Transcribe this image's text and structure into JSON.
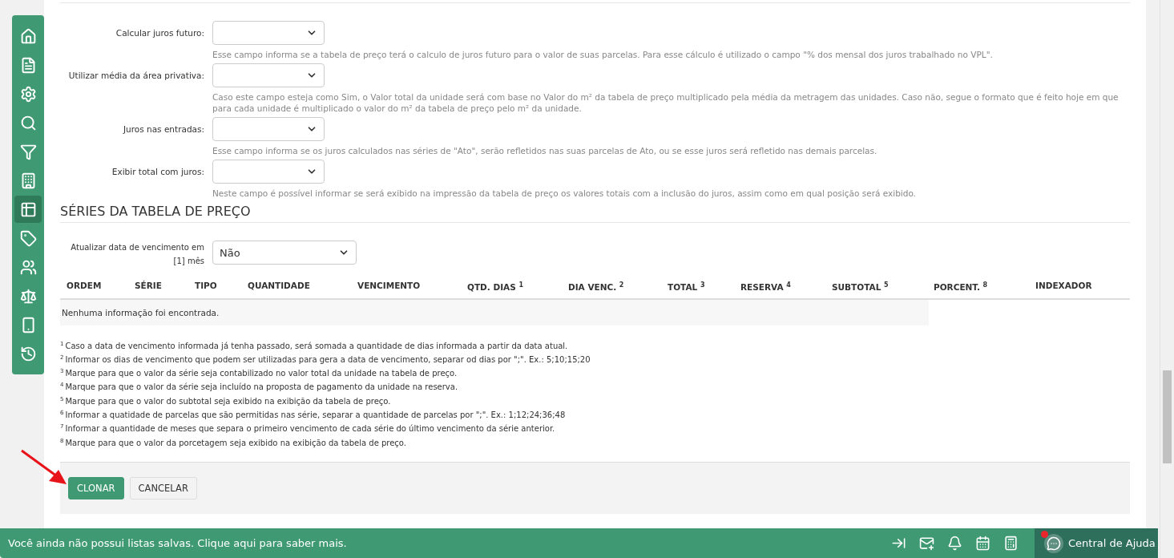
{
  "sidebar": {
    "items": [
      {
        "kind": "home",
        "selected": false
      },
      {
        "kind": "document",
        "selected": false
      },
      {
        "kind": "settings",
        "selected": false
      },
      {
        "kind": "search",
        "selected": false
      },
      {
        "kind": "filter",
        "selected": false
      },
      {
        "kind": "building",
        "selected": false
      },
      {
        "kind": "table",
        "selected": true
      },
      {
        "kind": "tag",
        "selected": false
      },
      {
        "kind": "users",
        "selected": false
      },
      {
        "kind": "scale",
        "selected": false
      },
      {
        "kind": "phone",
        "selected": false
      },
      {
        "kind": "history",
        "selected": false
      }
    ]
  },
  "settings": [
    {
      "label": "Calcular juros futuro:",
      "help": "Esse campo informa se a tabela de preço terá o calculo de juros futuro para o valor de suas parcelas. Para esse cálculo é utilizado o campo \"% dos mensal dos juros trabalhado no VPL\"."
    },
    {
      "label": "Utilizar média da área privativa:",
      "help": "Caso este campo esteja como Sim, o Valor total da unidade será com base no Valor do m² da tabela de preço multiplicado pela média da metragem das unidades. Caso não, segue o formato que é feito hoje em que para cada unidade é multiplicado o valor do m² da tabela de preço pelo m² da unidade."
    },
    {
      "label": "Juros nas entradas:",
      "help": "Esse campo informa se os juros calculados nas séries de \"Ato\", serão refletidos nas suas parcelas de Ato, ou se esse juros será refletido nas demais parcelas."
    },
    {
      "label": "Exibir total com juros:",
      "help": "Neste campo é possível informar se será exibido na impressão da tabela de preço os valores totais com a inclusão do juros, assim como em qual posição será exibido."
    }
  ],
  "series": {
    "title": "SÉRIES DA TABELA DE PREÇO",
    "update_due_date": {
      "label": "Atualizar data de vencimento em [1] mês",
      "value": "Não"
    },
    "table": {
      "columns": [
        "ORDEM",
        "SÉRIE",
        "TIPO",
        "QUANTIDADE",
        "VENCIMENTO",
        "QTD. DIAS $^{1}$",
        "DIA VENC. $^{2}$",
        "TOTAL $^{3}$",
        "RESERVA $^{4}$",
        "SUBTOTAL $^{5}$",
        "PORCENT. $^{8}$",
        "INDEXADOR"
      ],
      "empty_message": "Nenhuma informação foi encontrada."
    },
    "footnotes": [
      {
        "mark": "1",
        "text": "Caso a data de vencimento informada já tenha passado, será somada a quantidade de dias informada a partir da data atual."
      },
      {
        "mark": "2",
        "text": "Informar os dias de vencimento que podem ser utilizadas para gera a data de vencimento, separar od dias por \";\". Ex.: 5;10;15;20"
      },
      {
        "mark": "3",
        "text": "Marque para que o valor da série seja contabilizado no valor total da unidade na tabela de preço."
      },
      {
        "mark": "4",
        "text": "Marque para que o valor da série seja incluído na proposta de pagamento da unidade na reserva."
      },
      {
        "mark": "5",
        "text": "Marque para que o valor do subtotal seja exibido na exibição da tabela de preço."
      },
      {
        "mark": "6",
        "text": "Informar a quatidade de parcelas que são permitidas nas série, separar a quantidade de parcelas por \";\". Ex.: 1;12;24;36;48"
      },
      {
        "mark": "7",
        "text": "Informar a quantidade de meses que separa o primeiro vencimento de cada série do último vencimento da série anterior."
      },
      {
        "mark": "8",
        "text": "Marque para que o valor da porcetagem seja exibido na exibição da tabela de preço."
      }
    ]
  },
  "actions": [
    {
      "kind": "primary",
      "label": "CLONAR"
    },
    {
      "kind": "secondary",
      "label": "CANCELAR"
    }
  ],
  "footer": {
    "message": "Você ainda não possui listas salvas. Clique aqui para saber mais.",
    "tools": [
      {
        "kind": "collapse"
      },
      {
        "kind": "mail"
      },
      {
        "kind": "bell"
      },
      {
        "kind": "calendar"
      },
      {
        "kind": "calculator"
      }
    ],
    "help": {
      "label": "Central de Ajuda",
      "notification": true
    }
  }
}
